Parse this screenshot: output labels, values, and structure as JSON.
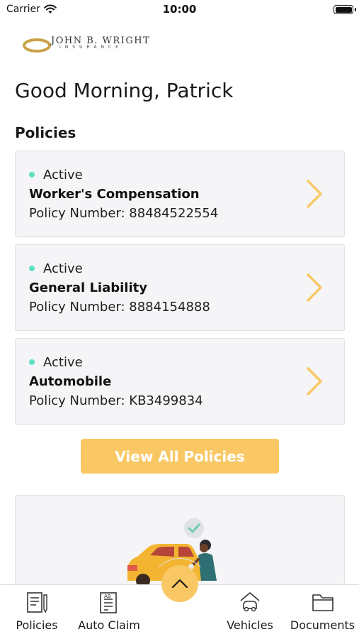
{
  "status_bar": {
    "carrier": "Carrier",
    "time": "10:00",
    "battery_level": 1.0
  },
  "logo": {
    "name": "JOHN B. WRIGHT",
    "sub": "INSURANCE",
    "brand_color": "#c9a349"
  },
  "greeting": "Good Morning, Patrick",
  "policies_section": {
    "title": "Policies",
    "items": [
      {
        "status": "Active",
        "name": "Worker's Compensation",
        "number": "Policy Number: 88484522554"
      },
      {
        "status": "Active",
        "name": "General Liability",
        "number": "Policy Number: 8884154888"
      },
      {
        "status": "Active",
        "name": "Automobile",
        "number": "Policy Number: KB3499834"
      }
    ],
    "status_color": "#5ee0c0",
    "chevron_color": "#f9c865"
  },
  "view_all_button": {
    "label": "View All Policies",
    "color": "#f9c865"
  },
  "promo": {
    "icon": "car-repair-illustration"
  },
  "tab_bar": {
    "items": [
      {
        "label": "Policies",
        "icon": "document-pen-icon"
      },
      {
        "label": "Auto Claim",
        "icon": "claim-form-icon"
      },
      {
        "label": "",
        "icon": "chevron-up-icon"
      },
      {
        "label": "Vehicles",
        "icon": "car-house-icon"
      },
      {
        "label": "Documents",
        "icon": "folder-icon"
      }
    ],
    "accent": "#f9c865"
  }
}
